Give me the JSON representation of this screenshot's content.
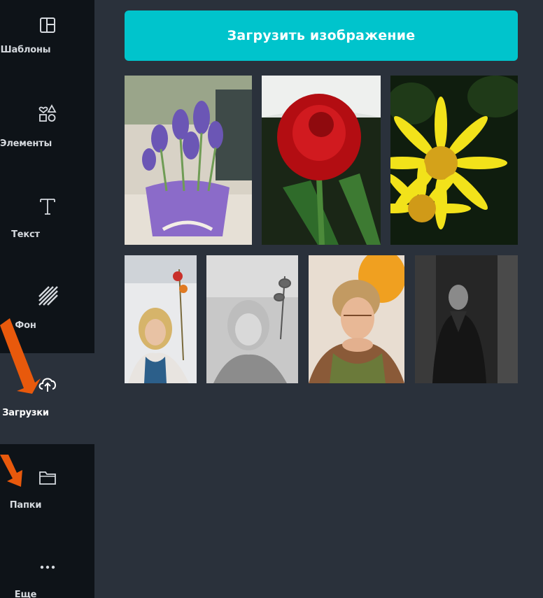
{
  "sidebar": {
    "items": [
      {
        "label": "Шаблоны",
        "icon": "templates-icon"
      },
      {
        "label": "Элементы",
        "icon": "elements-icon"
      },
      {
        "label": "Текст",
        "icon": "text-icon"
      },
      {
        "label": "Фон",
        "icon": "background-icon"
      },
      {
        "label": "Загрузки",
        "icon": "upload-cloud-icon",
        "active": true
      },
      {
        "label": "Папки",
        "icon": "folder-icon"
      },
      {
        "label": "Еще",
        "icon": "more-icon"
      }
    ]
  },
  "upload": {
    "button_label": "Загрузить изображение"
  },
  "gallery": {
    "images": [
      {
        "name": "purple-crocus-photo"
      },
      {
        "name": "red-rose-photo"
      },
      {
        "name": "yellow-daisy-photo"
      },
      {
        "name": "woman-with-flowers-color-photo"
      },
      {
        "name": "woman-with-flowers-bw-photo"
      },
      {
        "name": "woman-with-balloon-photo"
      },
      {
        "name": "man-dark-portrait-photo"
      }
    ]
  },
  "colors": {
    "sidebar_bg": "#0e1318",
    "panel_bg": "#2a313b",
    "accent": "#00c4cc",
    "arrow": "#e8590c"
  }
}
